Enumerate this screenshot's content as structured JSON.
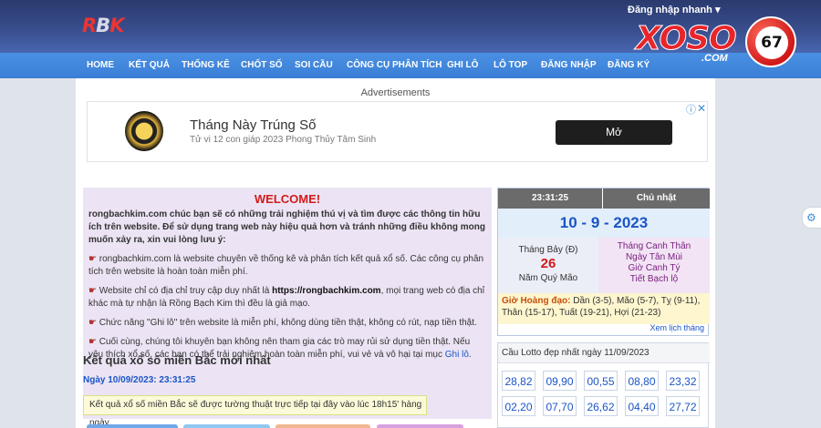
{
  "brand": {
    "logo_parts": [
      "R",
      "B",
      "K"
    ]
  },
  "header": {
    "login_quick": "Đăng nhập nhanh ▾"
  },
  "xoso_logo": {
    "word": "XOSO",
    "domain": ".COM",
    "number": "67"
  },
  "nav": [
    "HOME",
    "KẾT QUẢ",
    "THỐNG KÊ",
    "CHỐT SỐ",
    "SOI CẦU",
    "CÔNG CỤ PHÂN TÍCH",
    "GHI LÔ",
    "LÔ TOP",
    "ĐĂNG NHẬP",
    "ĐĂNG KÝ"
  ],
  "ad": {
    "label": "Advertisements",
    "title": "Tháng Này Trúng Số",
    "subtitle": "Tử vi 12 con giáp 2023 Phong Thủy Tâm Sinh",
    "button": "Mở",
    "info_icon": "ⓘ",
    "close_icon": "✕"
  },
  "welcome": {
    "heading": "WELCOME!",
    "intro": "rongbachkim.com chúc bạn sẽ có những trải nghiệm thú vị và tìm được các thông tin hữu ích trên website. Để sử dụng trang web này hiệu quả hơn và tránh những điều không mong muốn xảy ra, xin vui lòng lưu ý:",
    "p1": " rongbachkim.com là website chuyên về thống kê và phân tích kết quả xổ số. Các công cụ phân tích trên website là hoàn toàn miễn phí.",
    "p2a": " Website chỉ có địa chỉ truy cập duy nhất là ",
    "p2url": "https://rongbachkim.com",
    "p2b": ", mọi trang web có địa chỉ khác mà tự nhận là Rồng Bạch Kim thì đều là giả mạo.",
    "p3": " Chức năng \"Ghi lô\" trên website là miễn phí, không dùng tiền thật, không có rút, nạp tiền thật.",
    "p4a": " Cuối cùng, chúng tôi khuyên bạn không nên tham gia các trò may rủi sử dụng tiền thật. Nếu yêu thích xổ số, các bạn có thể trải nghiệm hoàn toàn miễn phí, vui vẻ và vô hại tại mục ",
    "p4link": "Ghi lô",
    "p4b": "."
  },
  "results": {
    "title": "Kết quả xổ số miền Bắc mới nhất",
    "date": "Ngày 10/09/2023: 23:31:25",
    "notice": "Kết quả xổ số miền Bắc sẽ được tường thuật trực tiếp tại đây vào lúc 18h15' hàng ngày."
  },
  "calendar": {
    "time": "23:31:25",
    "weekday": "Chủ nhật",
    "date": "10 - 9 - 2023",
    "lunar_month": "Tháng Bảy (Đ)",
    "lunar_day": "26",
    "lunar_year": "Năm Quý Mão",
    "can_chi": [
      "Tháng Canh Thân",
      "Ngày Tân Mùi",
      "Giờ Canh Tý",
      "Tiết Bạch lộ"
    ],
    "hoang_dao_label": "Giờ Hoàng đạo:",
    "hoang_dao": " Dần (3-5), Mão (5-7), Tỵ (9-11), Thân (15-17), Tuất (19-21), Hợi (21-23)",
    "more": "Xem lịch tháng"
  },
  "lotto": {
    "title": "Cầu Lotto đẹp nhất ngày 11/09/2023",
    "numbers": [
      "28,82",
      "09,90",
      "00,55",
      "08,80",
      "23,32",
      "02,20",
      "07,70",
      "26,62",
      "04,40",
      "27,72"
    ]
  },
  "side_widget": {
    "icon": "⚙"
  }
}
